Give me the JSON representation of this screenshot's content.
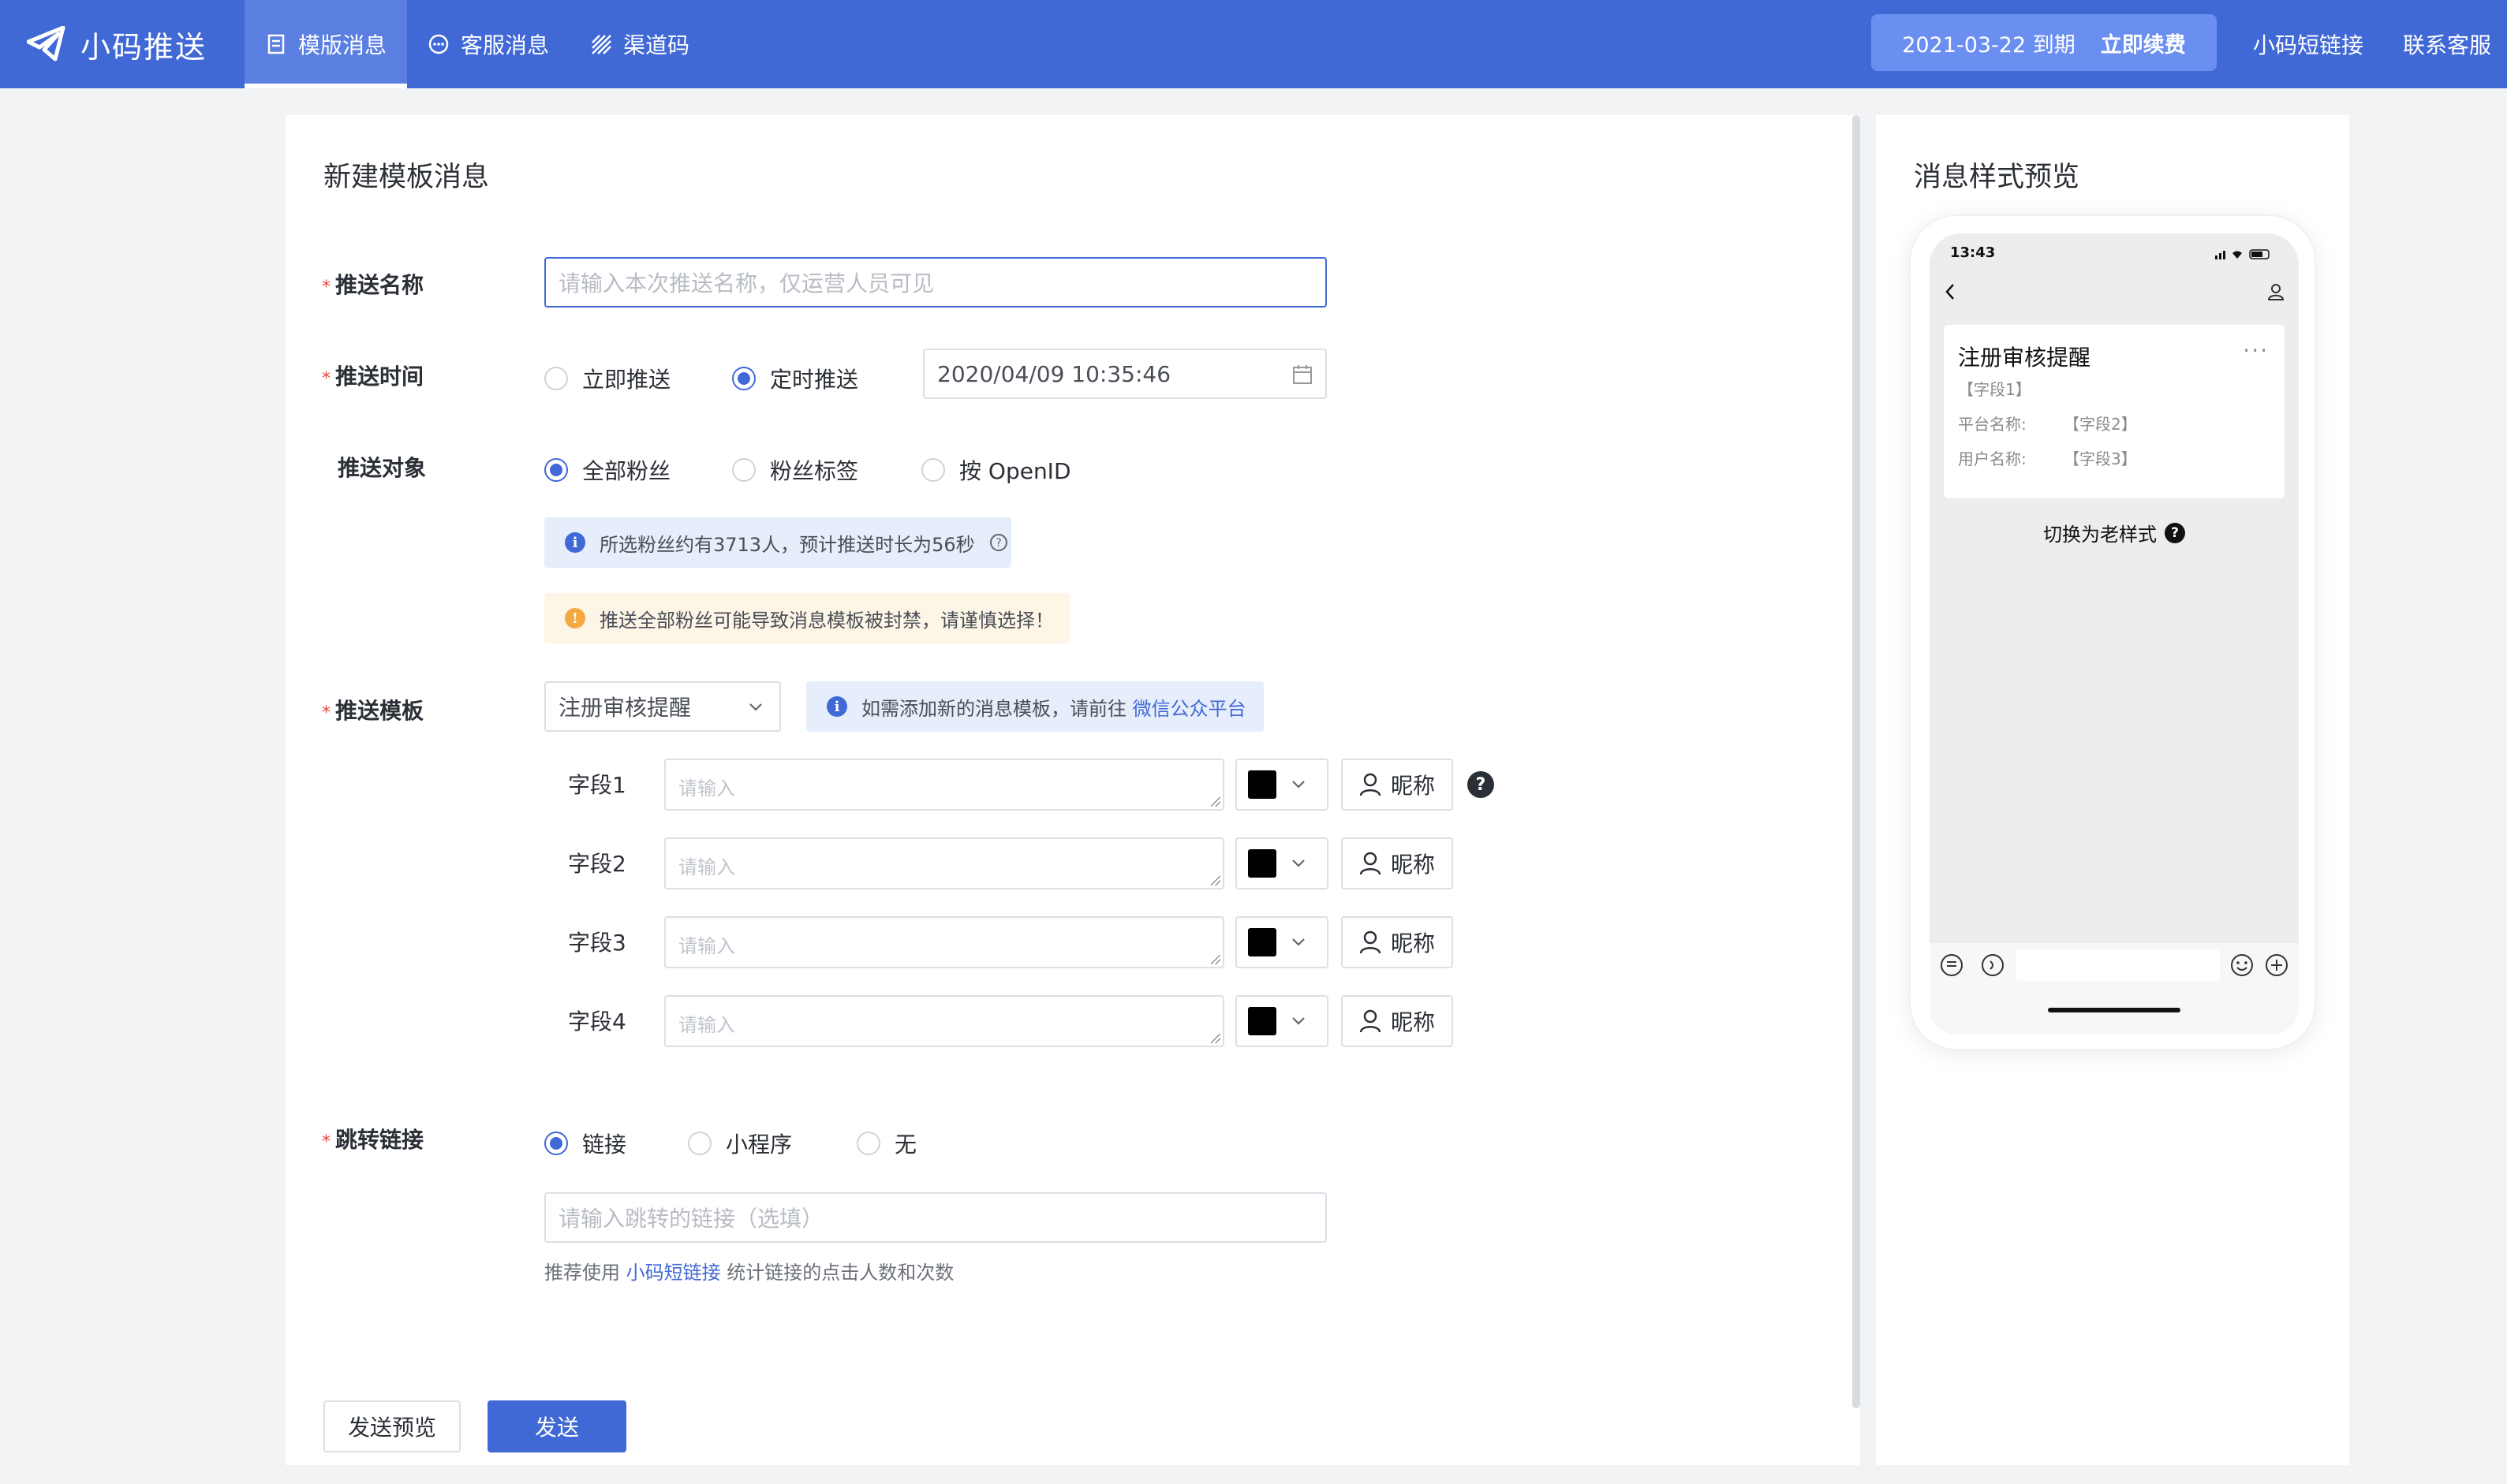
{
  "app": {
    "name": "小码推送"
  },
  "nav": {
    "items": [
      {
        "label": "模版消息"
      },
      {
        "label": "客服消息"
      },
      {
        "label": "渠道码"
      }
    ]
  },
  "header": {
    "expire": "2021-03-22 到期",
    "renew": "立即续费",
    "link1": "小码短链接",
    "link2": "联系客服"
  },
  "form": {
    "title": "新建模板消息",
    "name": {
      "label": "推送名称",
      "placeholder": "请输入本次推送名称，仅运营人员可见"
    },
    "time": {
      "label": "推送时间",
      "opt1": "立即推送",
      "opt2": "定时推送",
      "value": "2020/04/09 10:35:46"
    },
    "target": {
      "label": "推送对象",
      "opt1": "全部粉丝",
      "opt2": "粉丝标签",
      "opt3": "按 OpenID",
      "info": "所选粉丝约有3713人，预计推送时长为56秒",
      "warn": "推送全部粉丝可能导致消息模板被封禁，请谨慎选择！"
    },
    "template": {
      "label": "推送模板",
      "selected": "注册审核提醒",
      "info": "如需添加新的消息模板，请前往",
      "info_link": "微信公众平台",
      "fields": [
        {
          "label": "字段1",
          "placeholder": "请输入",
          "nick": "昵称"
        },
        {
          "label": "字段2",
          "placeholder": "请输入",
          "nick": "昵称"
        },
        {
          "label": "字段3",
          "placeholder": "请输入",
          "nick": "昵称"
        },
        {
          "label": "字段4",
          "placeholder": "请输入",
          "nick": "昵称"
        }
      ]
    },
    "jump": {
      "label": "跳转链接",
      "opt1": "链接",
      "opt2": "小程序",
      "opt3": "无",
      "placeholder": "请输入跳转的链接（选填）",
      "hint_pre": "推荐使用",
      "hint_link": "小码短链接",
      "hint_post": "统计链接的点击人数和次数"
    },
    "buttons": {
      "preview": "发送预览",
      "send": "发送"
    }
  },
  "preview": {
    "title": "消息样式预览",
    "time": "13:43",
    "card_title": "注册审核提醒",
    "field1": "【字段1】",
    "row1_label": "平台名称:",
    "row1_value": "【字段2】",
    "row2_label": "用户名称:",
    "row2_value": "【字段3】",
    "switch": "切换为老样式"
  },
  "colors": {
    "primary": "#4169d6",
    "required": "#e8453c",
    "warn": "#f4a940"
  }
}
